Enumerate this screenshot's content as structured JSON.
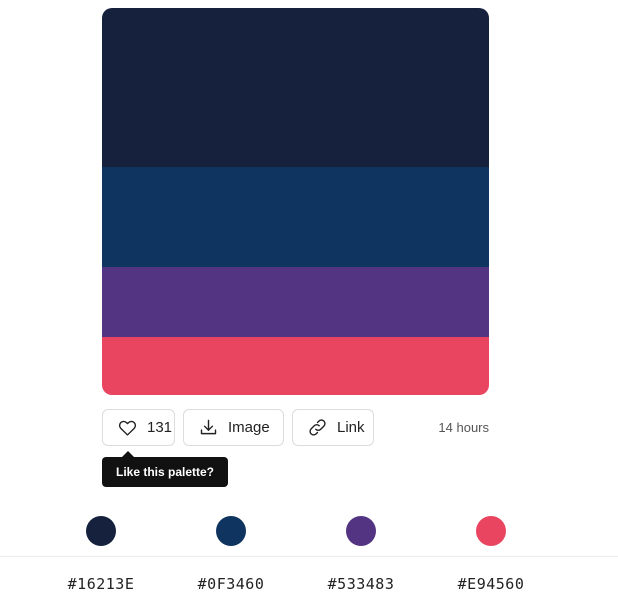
{
  "palette": {
    "colors": [
      {
        "hex": "#16213E",
        "color": "#16213E",
        "share": 0.41
      },
      {
        "hex": "#0F3460",
        "color": "#0F3460",
        "share": 0.26
      },
      {
        "hex": "#533483",
        "color": "#533483",
        "share": 0.18
      },
      {
        "hex": "#E94560",
        "color": "#E94560",
        "share": 0.15
      }
    ]
  },
  "actions": {
    "like_count": "131",
    "image_label": "Image",
    "link_label": "Link",
    "posted_ago": "14 hours"
  },
  "tooltip": {
    "text": "Like this palette?"
  },
  "icons": {
    "like": "heart-icon",
    "image": "download-icon",
    "link": "link-icon"
  }
}
